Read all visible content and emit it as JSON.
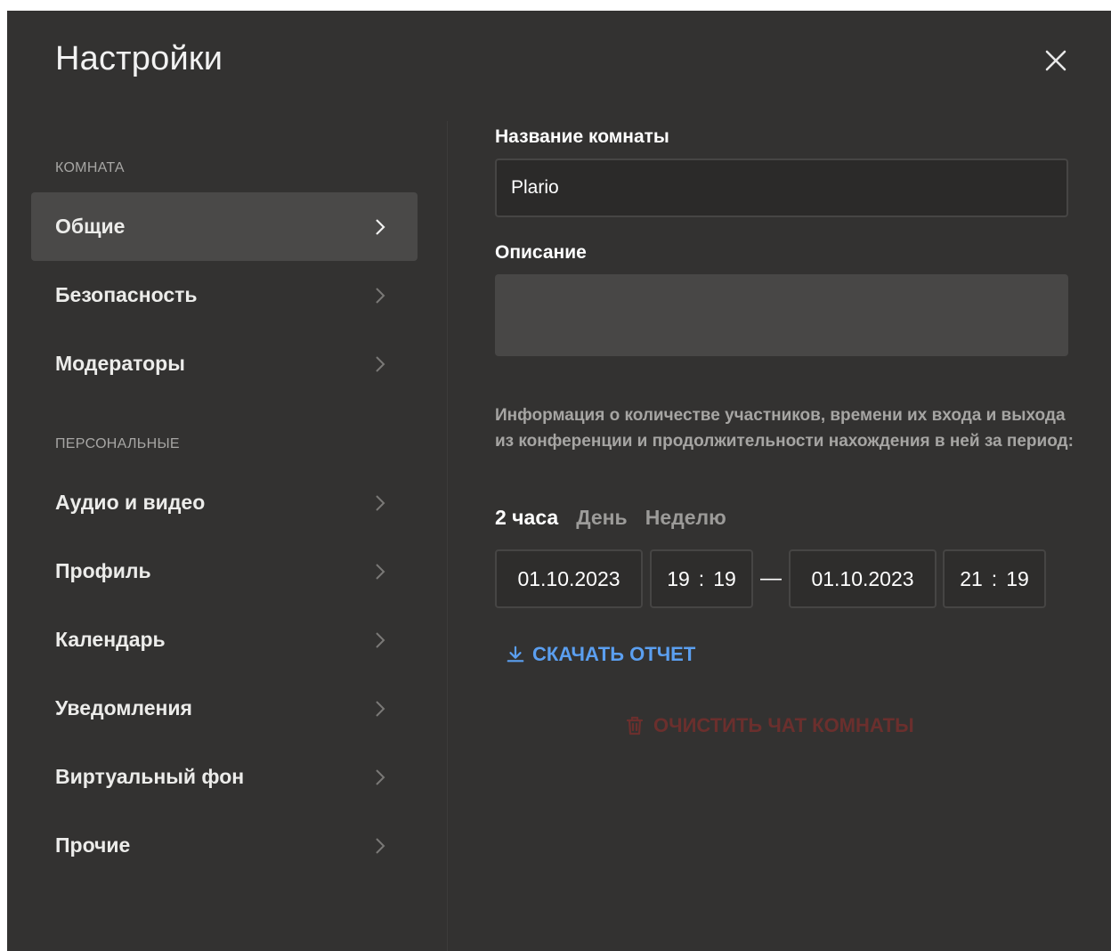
{
  "dialog": {
    "title": "Настройки"
  },
  "sidebar": {
    "sections": [
      {
        "label": "КОМНАТА",
        "items": [
          {
            "label": "Общие",
            "active": true
          },
          {
            "label": "Безопасность"
          },
          {
            "label": "Модераторы"
          }
        ]
      },
      {
        "label": "ПЕРСОНАЛЬНЫЕ",
        "items": [
          {
            "label": "Аудио и видео"
          },
          {
            "label": "Профиль"
          },
          {
            "label": "Календарь"
          },
          {
            "label": "Уведомления"
          },
          {
            "label": "Виртуальный фон"
          },
          {
            "label": "Прочие"
          }
        ]
      }
    ]
  },
  "main": {
    "room_name_label": "Название комнаты",
    "room_name_value": "Plario",
    "description_label": "Описание",
    "description_value": "",
    "info_text": "Информация о количестве участников, времени их входа и выхода из конференции и продолжительности нахождения в ней за период:",
    "periods": [
      {
        "label": "2 часа",
        "active": true
      },
      {
        "label": "День"
      },
      {
        "label": "Неделю"
      }
    ],
    "range": {
      "start_date": "01.10.2023",
      "start_hour": "19",
      "start_minute": "19",
      "separator": "—",
      "end_date": "01.10.2023",
      "end_hour": "21",
      "end_minute": "19"
    },
    "download_label": "СКАЧАТЬ ОТЧЕТ",
    "clear_label": "ОЧИСТИТЬ ЧАТ КОМНАТЫ"
  },
  "colors": {
    "background": "#333231",
    "active_item": "#4a4948",
    "accent_blue": "#5b9ff0",
    "danger_muted": "#6b2f2d"
  },
  "icons": {
    "close": "close-icon",
    "chevron": "chevron-right-icon",
    "download": "download-icon",
    "trash": "trash-icon"
  }
}
